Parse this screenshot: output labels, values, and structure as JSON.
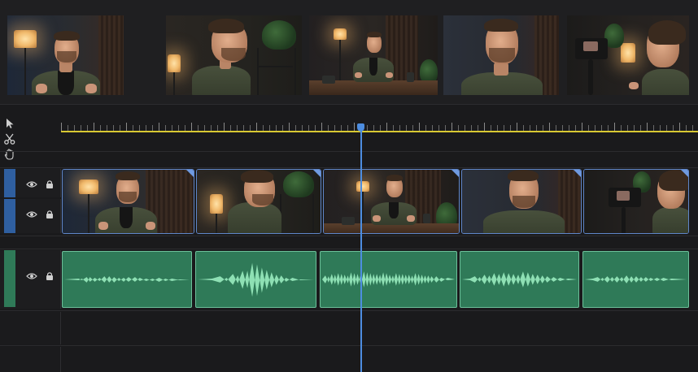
{
  "thumbnail_strip": {
    "thumbnails": [
      {
        "scene": "talking-head-wide-lamp-left"
      },
      {
        "scene": "profile-shelf-lamp"
      },
      {
        "scene": "seated-table-wide"
      },
      {
        "scene": "closeup-talking"
      },
      {
        "scene": "over-shoulder-camera"
      }
    ]
  },
  "tools": [
    {
      "name": "selection-tool",
      "icon": "arrow-pointer-icon"
    },
    {
      "name": "razor-tool",
      "icon": "scissors-icon"
    },
    {
      "name": "hand-tool",
      "icon": "hand-icon"
    }
  ],
  "timeline": {
    "playhead_color": "#4d8de0",
    "ruler_color": "#d8c832",
    "tracks": [
      {
        "type": "video",
        "color": "#2f5fa0",
        "visible": true,
        "locked": true
      },
      {
        "type": "video",
        "color": "#2f5fa0",
        "visible": true,
        "locked": true
      },
      {
        "type": "audio",
        "color": "#2f7a58",
        "visible": true,
        "locked": true
      }
    ],
    "video_clips": 5,
    "audio_clips": 5
  }
}
